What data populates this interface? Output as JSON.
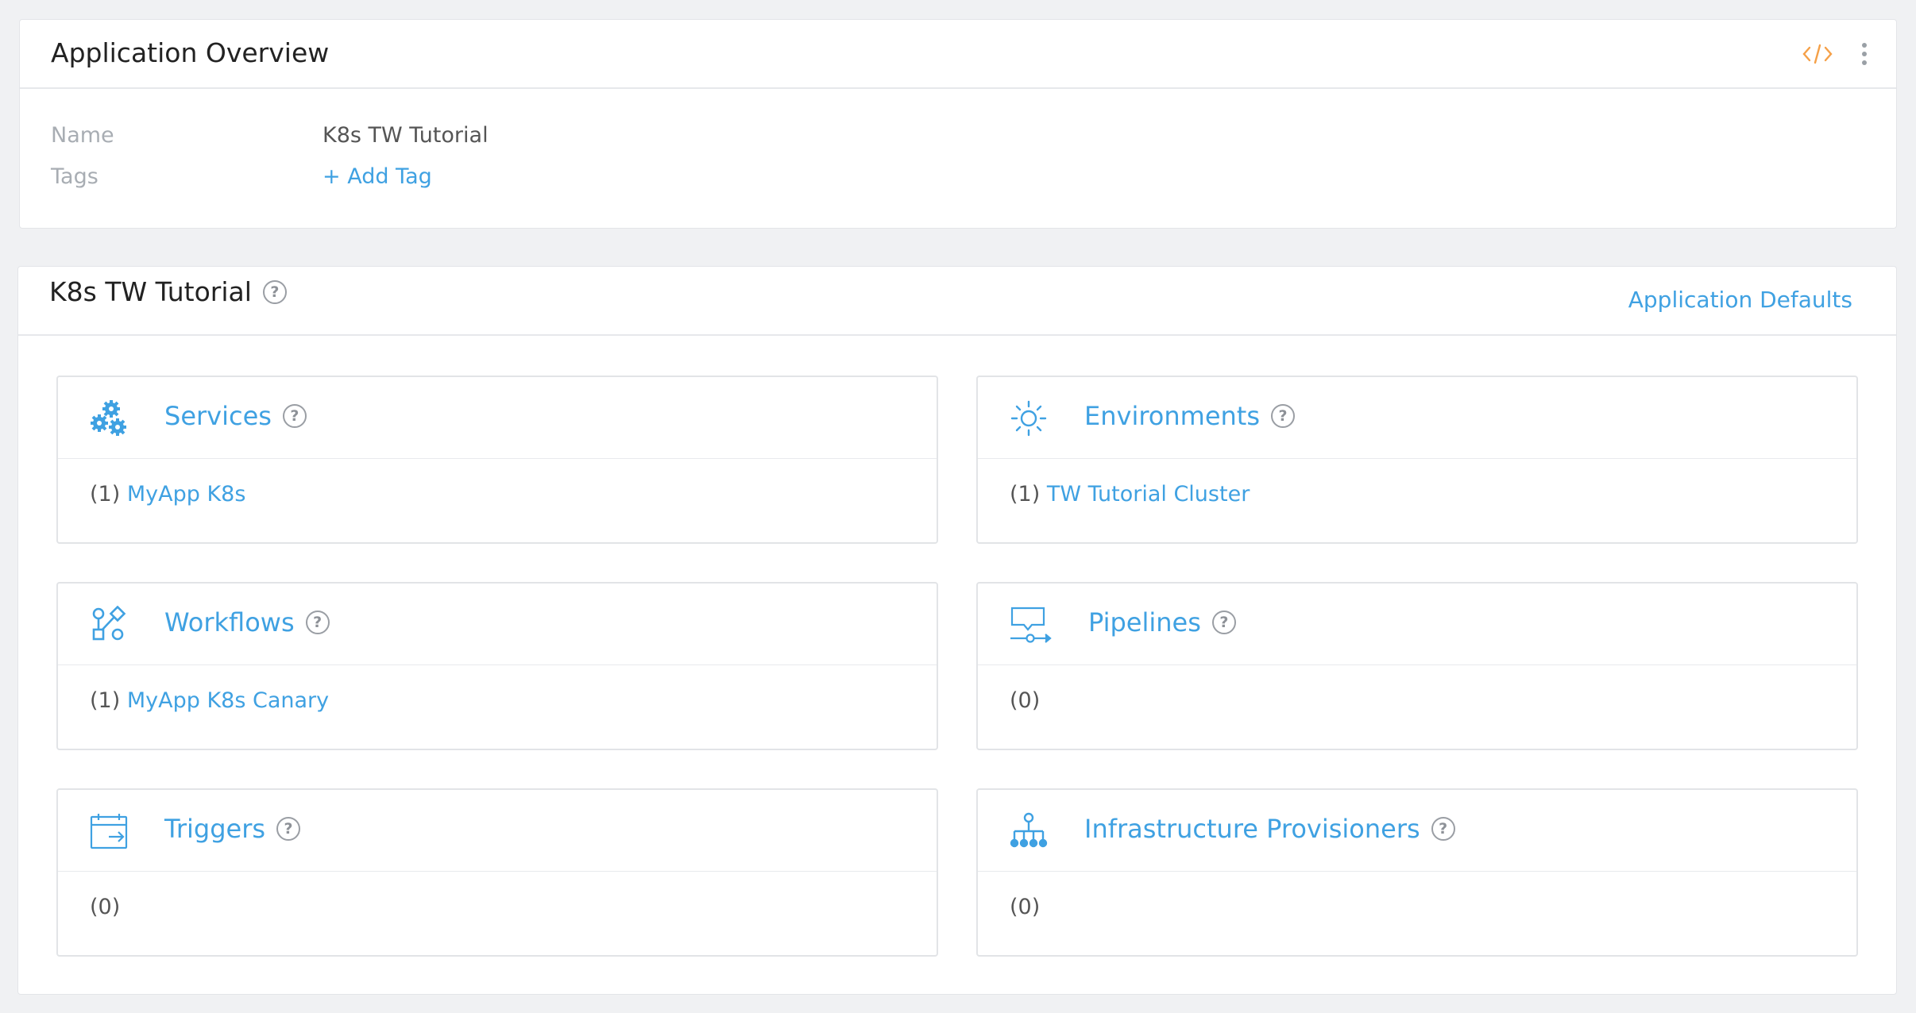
{
  "overview": {
    "title": "Application Overview",
    "name_label": "Name",
    "name_value": "K8s TW Tutorial",
    "tags_label": "Tags",
    "add_tag": "+ Add Tag"
  },
  "app": {
    "title": "K8s TW Tutorial",
    "help": "?",
    "defaults_link": "Application Defaults"
  },
  "cards": {
    "services": {
      "title": "Services",
      "count": "(1)",
      "item": "MyApp K8s",
      "icon": "services-gears-icon"
    },
    "environments": {
      "title": "Environments",
      "count": "(1)",
      "item": "TW Tutorial Cluster",
      "icon": "environment-sun-icon"
    },
    "workflows": {
      "title": "Workflows",
      "count": "(1)",
      "item": "MyApp K8s Canary",
      "icon": "workflow-icon"
    },
    "pipelines": {
      "title": "Pipelines",
      "count": "(0)",
      "item": "",
      "icon": "pipeline-icon"
    },
    "triggers": {
      "title": "Triggers",
      "count": "(0)",
      "item": "",
      "icon": "trigger-calendar-icon"
    },
    "provisioners": {
      "title": "Infrastructure Provisioners",
      "count": "(0)",
      "item": "",
      "icon": "provisioner-tree-icon"
    }
  },
  "colors": {
    "accent": "#3fa1e2",
    "code_icon": "#f5a048",
    "background": "#f0f1f3"
  }
}
